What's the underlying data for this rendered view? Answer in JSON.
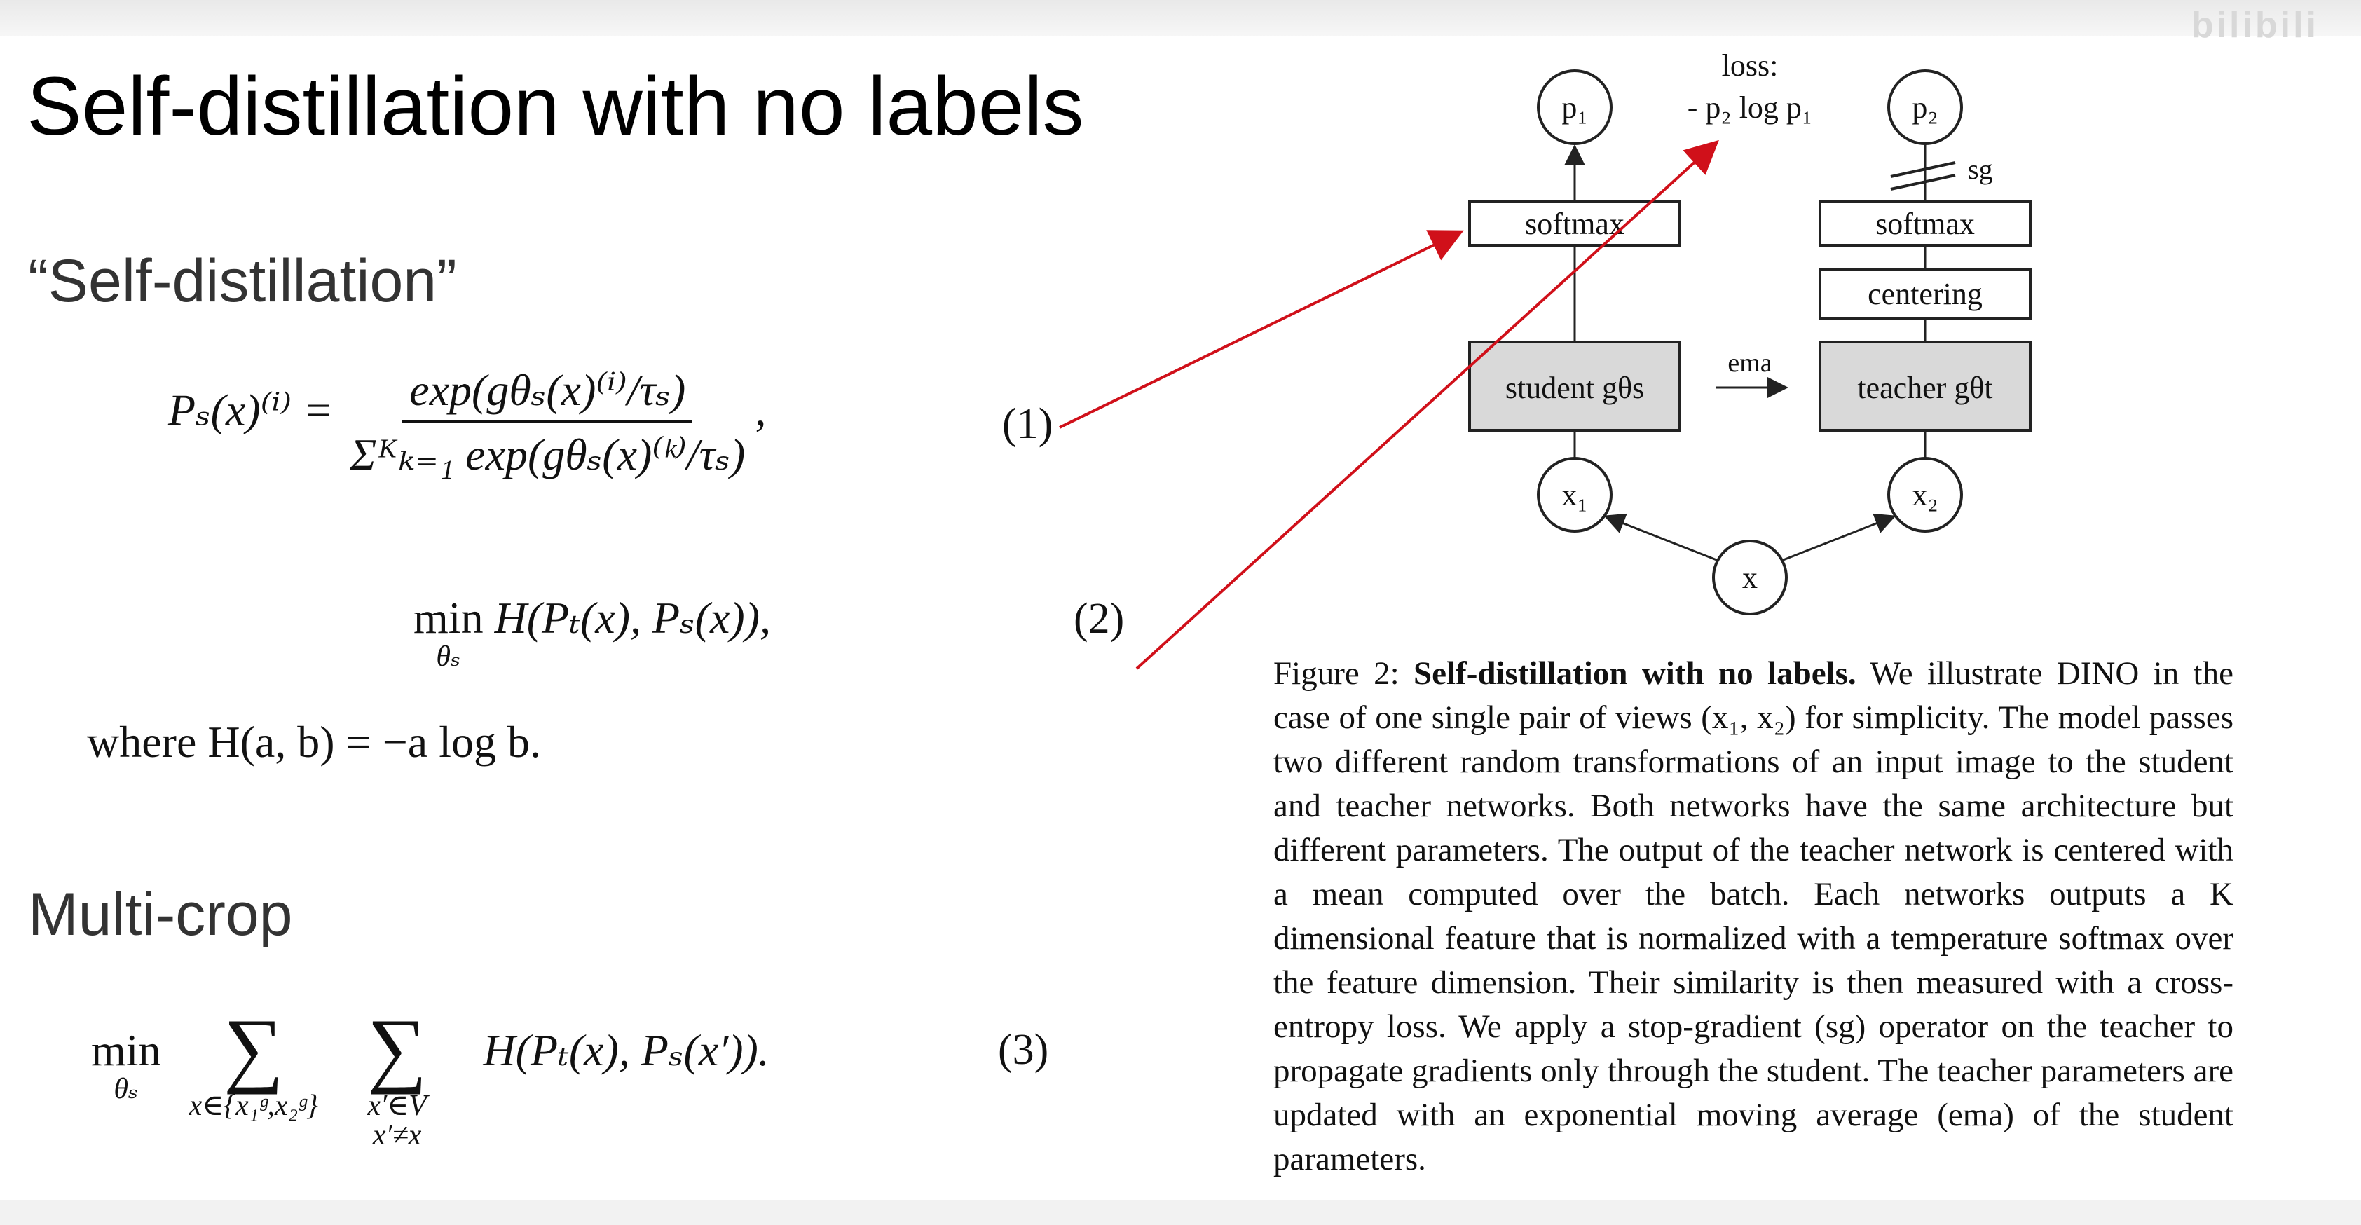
{
  "watermark": "bilibili",
  "slide": {
    "title": "Self-distillation with no labels",
    "sd_heading": "“Self-distillation”",
    "mc_heading": "Multi-crop"
  },
  "eq1": {
    "lhs": "Pₛ(x)⁽ⁱ⁾ =",
    "numerator": "exp(gθₛ(x)⁽ⁱ⁾/τₛ)",
    "denominator": "Σᴷₖ₌₁ exp(gθₛ(x)⁽ᵏ⁾/τₛ)",
    "comma": ",",
    "number": "(1)"
  },
  "eq2": {
    "min": "min",
    "sub": "θₛ",
    "expr": "H(Pₜ(x), Pₛ(x)),",
    "number": "(2)"
  },
  "where_text": "where H(a, b) = −a log b.",
  "eq3": {
    "min": "min",
    "sub": "θₛ",
    "sum_symbol": "∑",
    "sum1_sub": "x∈{x₁ᵍ,x₂ᵍ}",
    "sum2_sub1": "x′∈V",
    "sum2_sub2": "x′≠x",
    "expr": "H(Pₜ(x), Pₛ(x′)).",
    "number": "(3)"
  },
  "diagram": {
    "loss_label": "loss:",
    "loss_formula": "- p₂ log p₁",
    "p1": "p₁",
    "p2": "p₂",
    "sg": "sg",
    "softmax_left": "softmax",
    "softmax_right": "softmax",
    "centering": "centering",
    "student": "student gθs",
    "teacher": "teacher gθt",
    "ema": "ema",
    "x1": "x₁",
    "x2": "x₂",
    "x": "x"
  },
  "caption": {
    "lead": "Figure 2: ",
    "bold": "Self-distillation with no labels.",
    "body": " We illustrate DINO in the case of one single pair of views (x₁, x₂) for simplicity. The model passes two different random transformations of an input image to the student and teacher networks. Both networks have the same architecture but different parameters. The output of the teacher network is centered with a mean computed over the batch. Each networks outputs a K dimensional feature that is normalized with a temperature softmax over the feature dimension. Their similarity is then measured with a cross-entropy loss. We apply a stop-gradient (sg) operator on the teacher to propagate gradients only through the student. The teacher parameters are updated with an exponential moving average (ema) of the student parameters."
  },
  "colors": {
    "annotation": "#d0101a",
    "box_fill": "#d9d9d9",
    "stroke": "#222222"
  }
}
